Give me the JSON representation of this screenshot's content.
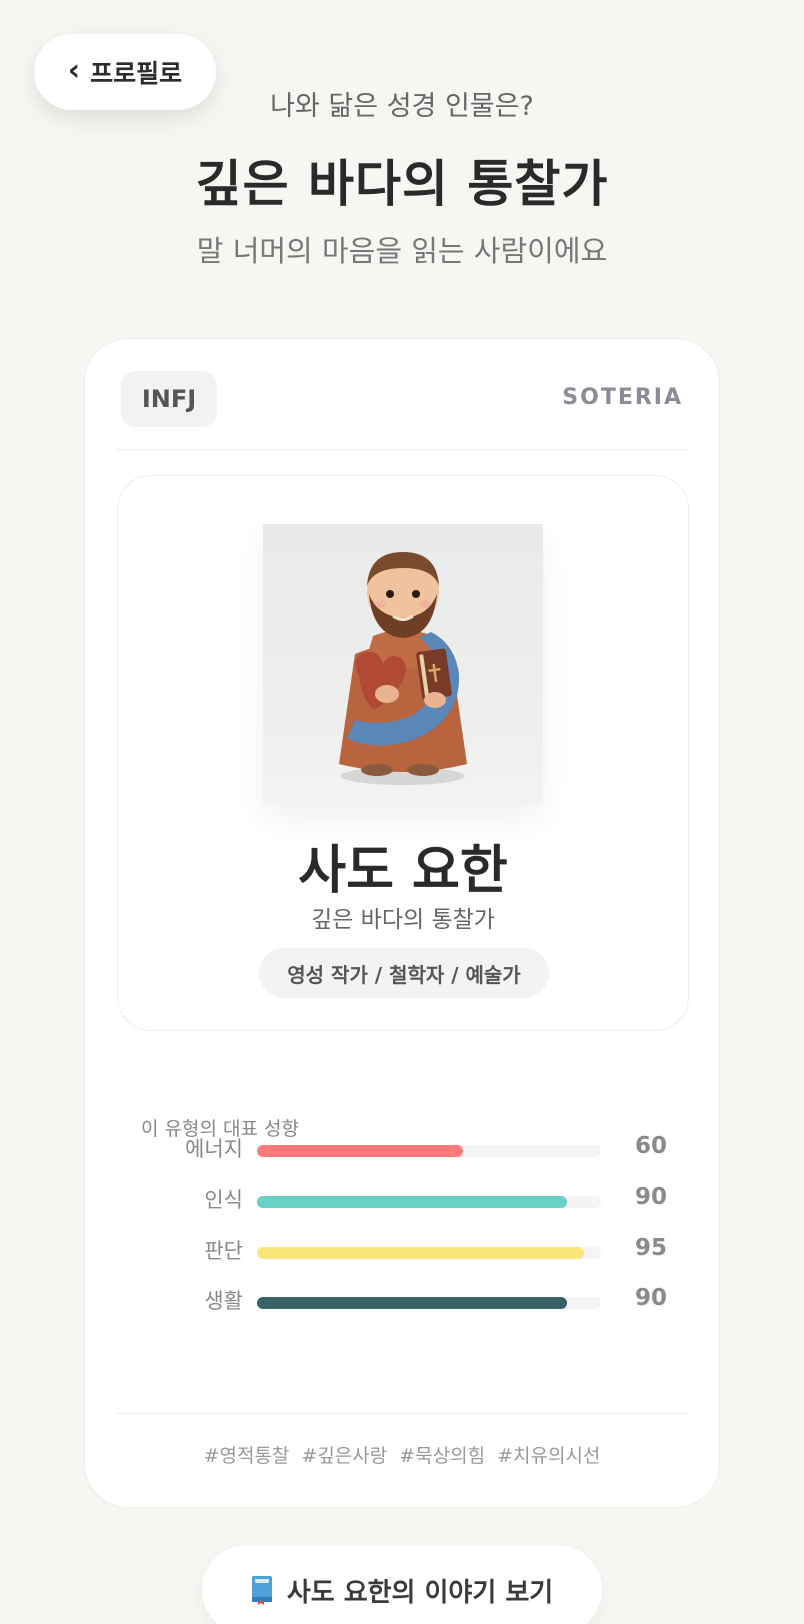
{
  "nav": {
    "back_label": "프로필로"
  },
  "header": {
    "question": "나와 닮은 성경 인물은?",
    "headline": "깊은 바다의 통찰가",
    "subline": "말 너머의 마음을 읽는 사람이에요"
  },
  "card": {
    "mbti": "INFJ",
    "brand": "SOTERIA",
    "figure": {
      "name": "사도 요한",
      "title": "깊은 바다의 통찰가",
      "roles": "영성 작가 / 철학자 / 예술가"
    },
    "traits": {
      "label": "이 유형의 대표 성향",
      "items": [
        {
          "name": "에너지",
          "value": 60,
          "color": "#ff7b7b"
        },
        {
          "name": "인식",
          "value": 90,
          "color": "#68d3c5"
        },
        {
          "name": "판단",
          "value": 95,
          "color": "#fae57a"
        },
        {
          "name": "생활",
          "value": 90,
          "color": "#396168"
        }
      ]
    },
    "hashtags": [
      "#영적통찰",
      "#깊은사랑",
      "#묵상의힘",
      "#치유의시선"
    ]
  },
  "actions": {
    "story_button_label": "사도 요한의 이야기 보기",
    "story_icon": "book-icon"
  }
}
